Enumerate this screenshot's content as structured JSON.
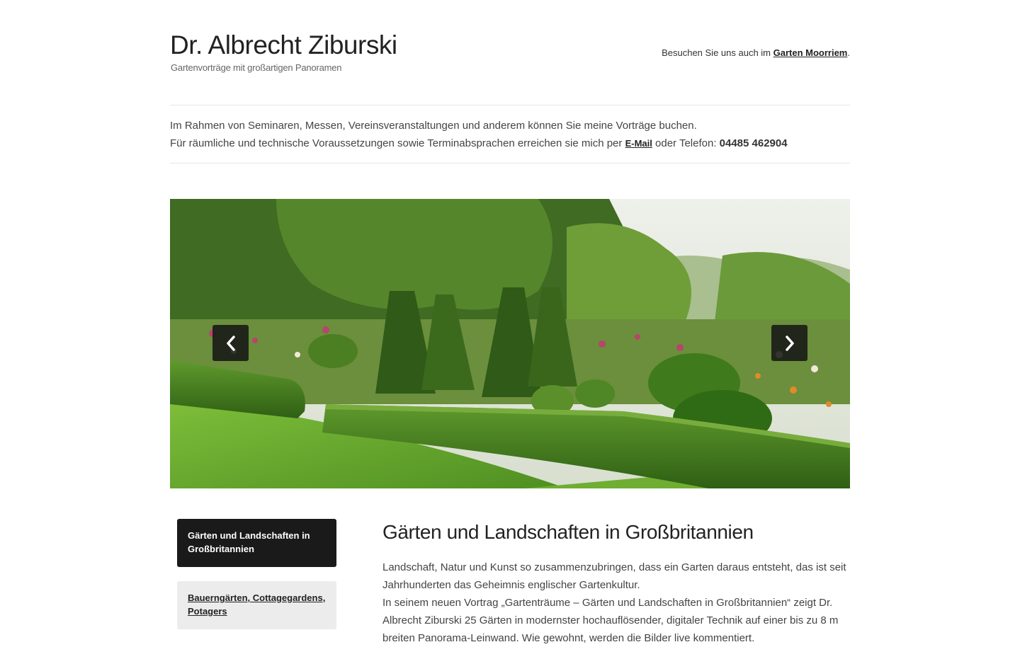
{
  "header": {
    "title": "Dr. Albrecht Ziburski",
    "tagline": "Gartenvorträge mit großartigen Panoramen",
    "visit_prefix": "Besuchen Sie uns auch im ",
    "visit_link": "Garten Moorriem",
    "visit_suffix": "."
  },
  "intro": {
    "line1": "Im Rahmen von Seminaren, Messen, Vereinsveranstaltungen und anderem können Sie meine Vorträge buchen.",
    "line2_prefix": "Für räumliche und technische Voraussetzungen sowie Terminabsprachen erreichen sie mich per ",
    "email_link": "E-Mail",
    "line2_middle": " oder Telefon: ",
    "phone": "04485 462904"
  },
  "slider": {
    "prev_icon": "chevron-left-icon",
    "next_icon": "chevron-right-icon"
  },
  "sidebar": {
    "items": [
      {
        "label": "Gärten und Landschaften in Großbritannien",
        "active": true
      },
      {
        "label": "Bauerngärten, Cottagegardens, Potagers",
        "active": false
      }
    ]
  },
  "content": {
    "title": "Gärten und Landschaften in Großbritannien",
    "paragraph1": "Landschaft, Natur und Kunst so zusammenzubringen, dass ein Garten daraus entsteht, das ist seit Jahrhunderten das Geheimnis englischer Gartenkultur.",
    "paragraph2": "In seinem neuen Vortrag „Gartenträume – Gärten und Landschaften in Großbritannien“ zeigt Dr. Albrecht Ziburski 25 Gärten in modernster hochauflösender, digitaler Technik auf einer bis zu 8 m breiten Panorama-Leinwand. Wie gewohnt, werden die Bilder live kommentiert."
  },
  "colors": {
    "accent_dark": "#1a1a1a",
    "sidebar_inactive": "#ececec"
  }
}
